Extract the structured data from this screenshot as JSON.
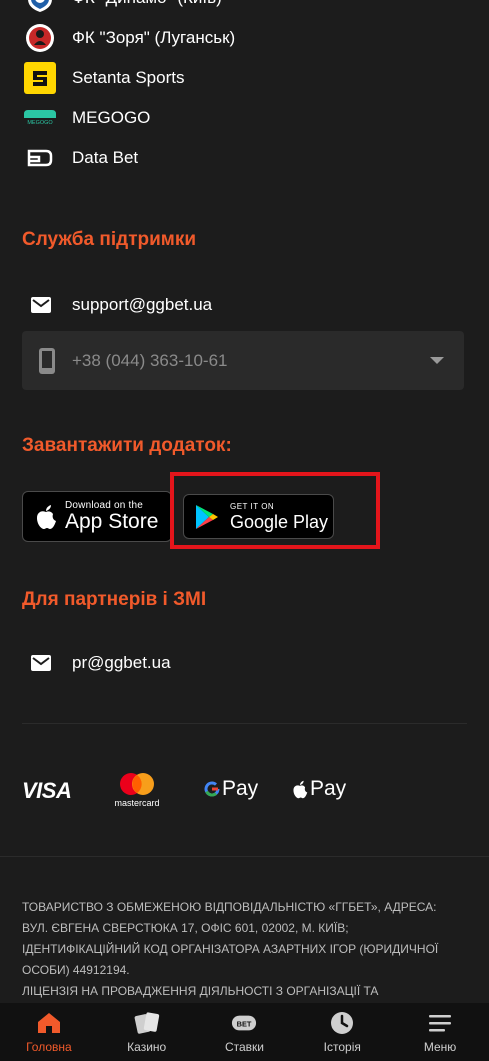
{
  "partners": [
    {
      "name": "ФК \"Динамо\" (Київ)",
      "icon": "dynamo-kyiv-logo"
    },
    {
      "name": "ФК \"Зоря\" (Луганськ)",
      "icon": "zorya-luhansk-logo"
    },
    {
      "name": "Setanta Sports",
      "icon": "setanta-sports-logo"
    },
    {
      "name": "MEGOGO",
      "icon": "megogo-logo",
      "logo_text": "MEGOGO"
    },
    {
      "name": "Data Bet",
      "icon": "data-bet-logo"
    }
  ],
  "support": {
    "title": "Служба підтримки",
    "email": "support@ggbet.ua",
    "phone": "+38 (044) 363-10-61"
  },
  "download": {
    "title": "Завантажити додаток:",
    "app_store": {
      "small": "Download on the",
      "big": "App Store"
    },
    "google_play": {
      "small": "GET IT ON",
      "big": "Google Play"
    }
  },
  "partners_media": {
    "title": "Для партнерів і ЗМІ",
    "email": "pr@ggbet.ua"
  },
  "payments": {
    "visa": "VISA",
    "mastercard": "mastercard",
    "gpay": "Pay",
    "applepay": "Pay"
  },
  "legal": {
    "line1": "ТОВАРИСТВО З ОБМЕЖЕНОЮ ВІДПОВІДАЛЬНІСТЮ «ГГБЕТ», АДРЕСА: ВУЛ. ЄВГЕНА СВЕРСТЮКА 17, ОФІС 601, 02002, М. КИЇВ; ІДЕНТИФІКАЦІЙНИЙ КОД ОРГАНІЗАТОРА АЗАРТНИХ ІГОР (ЮРИДИЧНОЇ ОСОБИ) 44912194.",
    "line2": "ЛІЦЕНЗІЯ НА ПРОВАДЖЕННЯ ДІЯЛЬНОСТІ З ОРГАНІЗАЦІЇ ТА"
  },
  "nav": {
    "items": [
      {
        "label": "Головна",
        "icon": "home-icon",
        "active": true
      },
      {
        "label": "Казино",
        "icon": "casino-cards-icon",
        "active": false
      },
      {
        "label": "Ставки",
        "icon": "bet-icon",
        "active": false,
        "icon_text": "BET"
      },
      {
        "label": "Історія",
        "icon": "clock-icon",
        "active": false
      },
      {
        "label": "Меню",
        "icon": "menu-icon",
        "active": false
      }
    ]
  },
  "colors": {
    "accent": "#f15a2b",
    "background": "#1c1c1c",
    "highlight": "#e4151b",
    "setanta_yellow": "#ffd600",
    "megogo_teal": "#2bc6a4"
  }
}
